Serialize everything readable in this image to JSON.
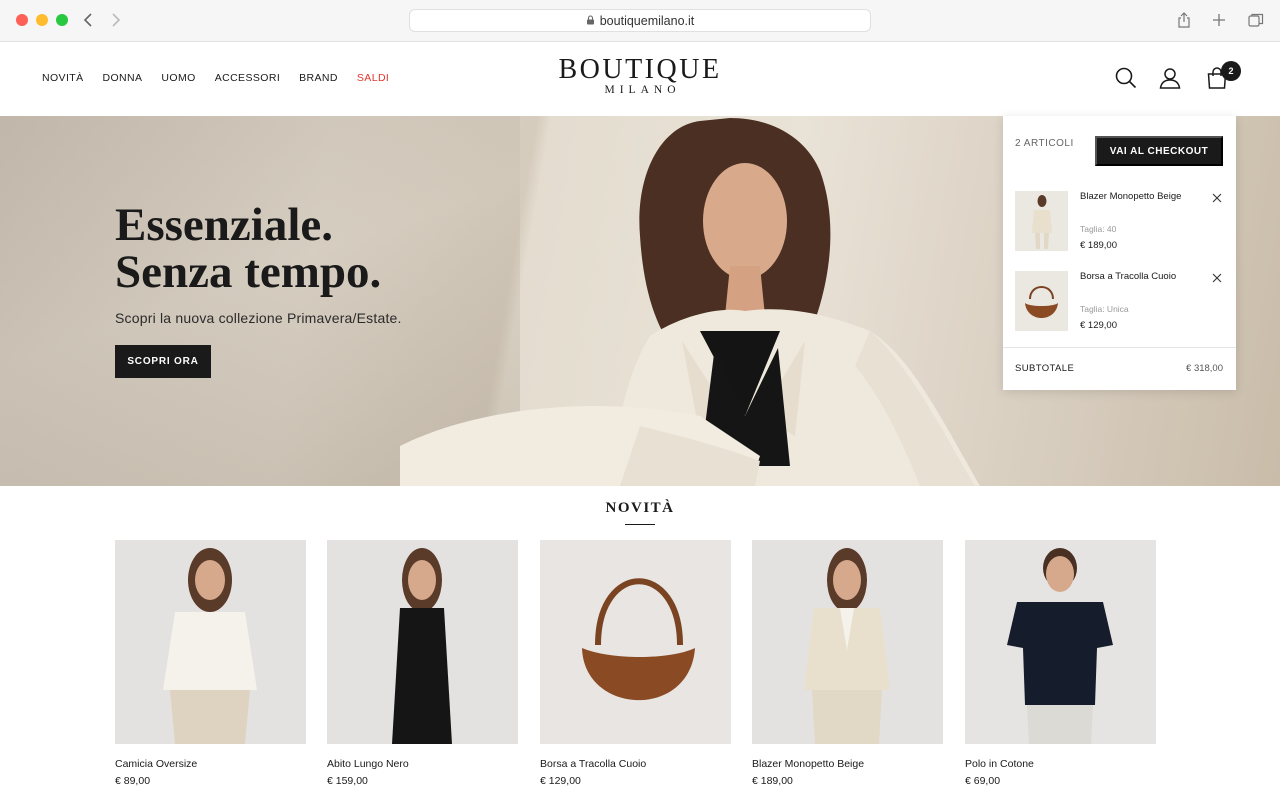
{
  "browser": {
    "url": "boutiquemilano.it"
  },
  "header": {
    "nav": [
      "NOVITÀ",
      "DONNA",
      "UOMO",
      "ACCESSORI",
      "BRAND",
      "SALDI"
    ],
    "logo_main": "BOUTIQUE",
    "logo_sub": "MILANO",
    "cart_count": "2",
    "sale_color": "#e0352b"
  },
  "hero": {
    "title_line1": "Essenziale.",
    "title_line2": "Senza tempo.",
    "subtitle": "Scopri la nuova collezione Primavera/Estate.",
    "cta": "SCOPRI ORA"
  },
  "cart": {
    "count_label": "2 ARTICOLI",
    "checkout_label": "VAI AL CHECKOUT",
    "items": [
      {
        "name": "Blazer Monopetto Beige",
        "size": "Taglia: 40",
        "price": "€ 189,00"
      },
      {
        "name": "Borsa a Tracolla Cuoio",
        "size": "Taglia: Unica",
        "price": "€ 129,00"
      }
    ],
    "subtotal_label": "SUBTOTALE",
    "subtotal_value": "€ 318,00"
  },
  "new_arrivals": {
    "title": "NOVITÀ",
    "products": [
      {
        "name": "Camicia Oversize",
        "price": "€ 89,00"
      },
      {
        "name": "Abito Lungo Nero",
        "price": "€ 159,00"
      },
      {
        "name": "Borsa a Tracolla Cuoio",
        "price": "€ 129,00"
      },
      {
        "name": "Blazer Monopetto Beige",
        "price": "€ 189,00"
      },
      {
        "name": "Polo in Cotone",
        "price": "€ 69,00"
      }
    ]
  }
}
